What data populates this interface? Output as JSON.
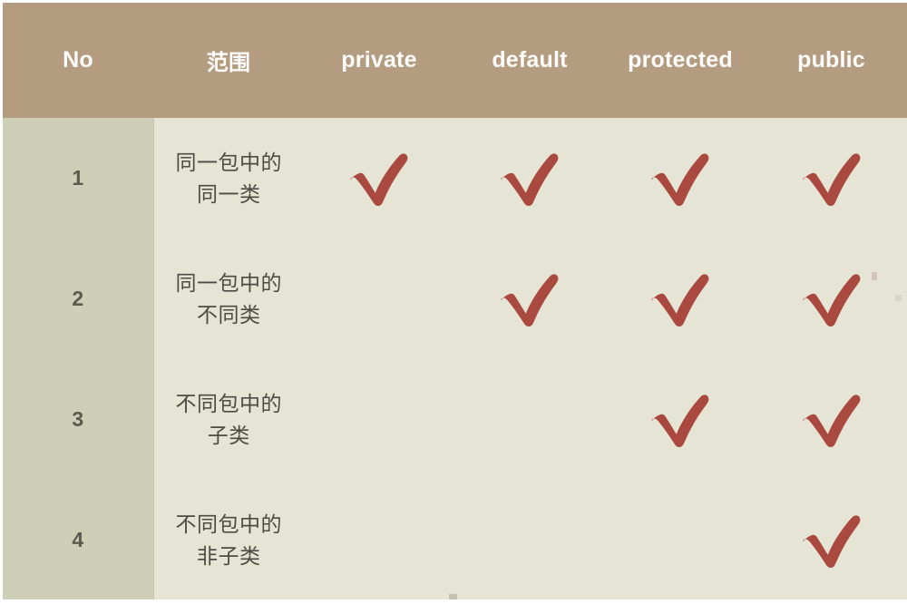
{
  "table": {
    "name": "java-access-modifier-scope-table",
    "colors": {
      "header_bg": "#b39c80",
      "header_text": "#fdfcfa",
      "index_col_bg": "#cfceb7",
      "cell_bg": "#e6e4d4",
      "body_text": "#4f4b42",
      "check_mark": "#a9493f",
      "grid_line": "#d7d5c2",
      "page_bg": "#ffffff"
    },
    "columns": [
      {
        "key": "no",
        "label": "No"
      },
      {
        "key": "scope",
        "label": "范围"
      },
      {
        "key": "private",
        "label": "private"
      },
      {
        "key": "default",
        "label": "default"
      },
      {
        "key": "protected",
        "label": "protected"
      },
      {
        "key": "public",
        "label": "public"
      }
    ],
    "rows": [
      {
        "no": "1",
        "scope": "同一包中的同一类",
        "private": "check",
        "default": "check",
        "protected": "check",
        "public": "check"
      },
      {
        "no": "2",
        "scope": "同一包中的不同类",
        "private": "",
        "default": "check",
        "protected": "check",
        "public": "check"
      },
      {
        "no": "3",
        "scope": "不同包中的子类",
        "private": "",
        "default": "",
        "protected": "check",
        "public": "check"
      },
      {
        "no": "4",
        "scope": "不同包中的非子类",
        "private": "",
        "default": "",
        "protected": "",
        "public": "check"
      }
    ],
    "icons": {
      "check": "check-mark-icon"
    }
  }
}
